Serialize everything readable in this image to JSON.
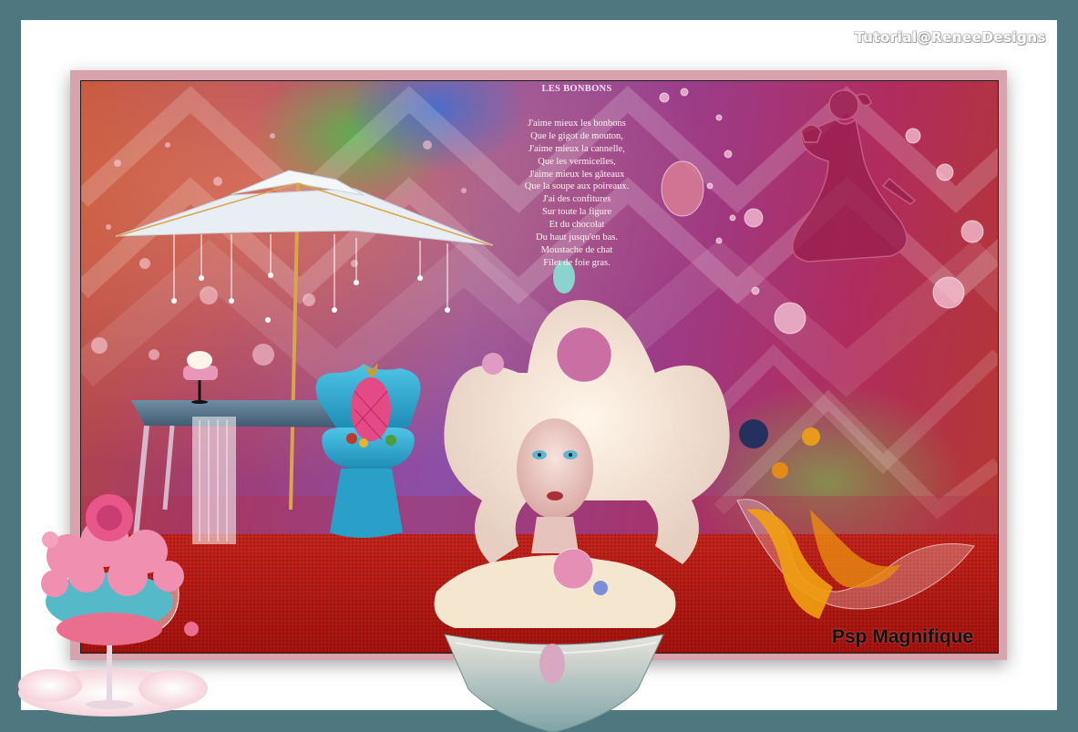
{
  "watermark": "Tutorial@ReneeDesigns",
  "poem": {
    "title": "LES BONBONS",
    "lines": [
      "J'aime mieux les bonbons",
      "Que le gigot de mouton,",
      "J'aime mieux la cannelle,",
      "Que les vermicelles,",
      "J'aime mieux les gâteaux",
      "Que la soupe aux poireaux.",
      "J'ai des confitures",
      "Sur toute la figure",
      "Et du chocolat",
      "Du haut jusqu'en bas.",
      "Moustache de chat",
      "Filet de foie gras."
    ]
  },
  "signature": "Psp Magnifique",
  "colors": {
    "outer_frame": "#4f7780",
    "inner_frame": "#ffffff",
    "pink_border": "#d9a3ad",
    "floor_red": "#c21f1a"
  }
}
